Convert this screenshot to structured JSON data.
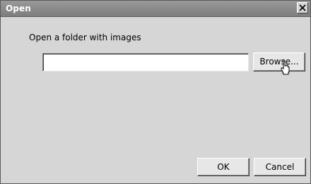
{
  "window": {
    "title": "Open",
    "close_icon": "close-icon"
  },
  "dialog": {
    "prompt": "Open a folder with images",
    "path_value": "",
    "path_placeholder": "",
    "browse_label": "Browse...",
    "ok_label": "OK",
    "cancel_label": "Cancel"
  },
  "cursor": {
    "icon": "hand-pointer-icon"
  },
  "colors": {
    "titlebar": "#8a8a8a",
    "background": "#d6d6d6",
    "button_face": "#e7e7e7"
  }
}
